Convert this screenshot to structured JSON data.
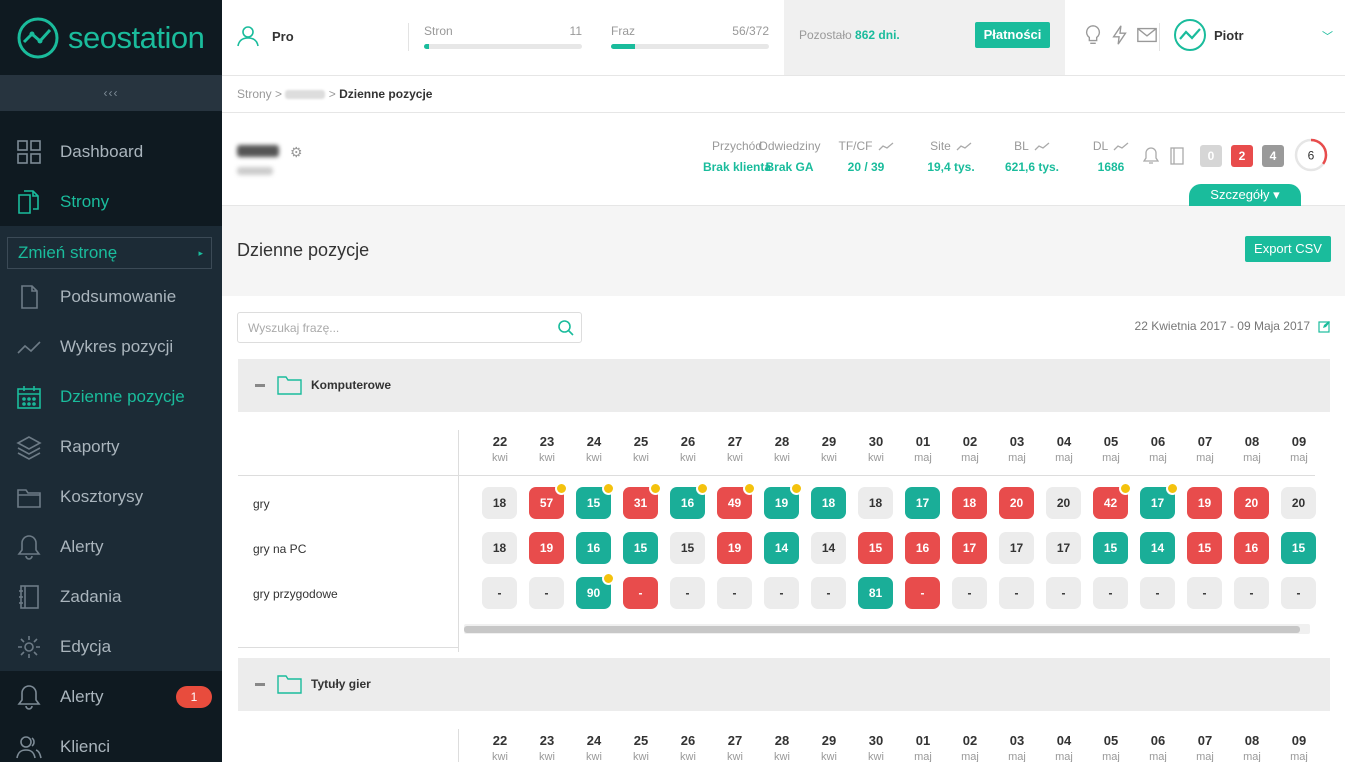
{
  "app": {
    "logo_a": "seo",
    "logo_b": "station"
  },
  "sidebar": {
    "collapse": "‹‹‹",
    "top_items": [
      {
        "label": "Dashboard",
        "icon": "grid-icon"
      },
      {
        "label": "Strony",
        "icon": "pages-icon"
      }
    ],
    "change_site": "Zmień stronę",
    "items": [
      {
        "label": "Podsumowanie",
        "icon": "document-icon"
      },
      {
        "label": "Wykres pozycji",
        "icon": "line-chart-icon"
      },
      {
        "label": "Dzienne pozycje",
        "icon": "calendar-icon"
      },
      {
        "label": "Raporty",
        "icon": "layers-icon"
      },
      {
        "label": "Kosztorysy",
        "icon": "folder-icon"
      },
      {
        "label": "Alerty",
        "icon": "bell-icon"
      },
      {
        "label": "Zadania",
        "icon": "notebook-icon"
      },
      {
        "label": "Edycja",
        "icon": "gear-icon"
      }
    ],
    "bottom_items": [
      {
        "label": "Alerty",
        "icon": "bell-icon",
        "badge": "1"
      },
      {
        "label": "Klienci",
        "icon": "users-icon"
      }
    ]
  },
  "topbar": {
    "plan": "Pro",
    "pages": {
      "label": "Stron",
      "value": "11",
      "fill": 0.03
    },
    "phrases": {
      "label": "Fraz",
      "value": "56/372",
      "fill": 0.15
    },
    "remaining_prefix": "Pozostało",
    "remaining_value": "862 dni.",
    "pay_button": "Płatności",
    "user": "Piotr"
  },
  "breadcrumb": {
    "root": "Strony",
    "sep": ">",
    "current": "Dzienne pozycje"
  },
  "site_stats": [
    {
      "label": "Przychód",
      "value": "Brak klienta",
      "trend": false
    },
    {
      "label": "Odwiedziny",
      "value": "Brak GA",
      "trend": false
    },
    {
      "label": "TF/CF",
      "value": "20 / 39",
      "trend": true
    },
    {
      "label": "Site",
      "value": "19,4 tys.",
      "trend": true
    },
    {
      "label": "BL",
      "value": "621,6 tys.",
      "trend": true
    },
    {
      "label": "DL",
      "value": "1686",
      "trend": true
    }
  ],
  "counters": [
    {
      "value": "0",
      "color": "#d6d6d6"
    },
    {
      "value": "2",
      "color": "#e84c4c"
    },
    {
      "value": "4",
      "color": "#9a9a9a"
    }
  ],
  "score": {
    "value": "6",
    "fraction": 0.35
  },
  "details_button": "Szczegóły ▾",
  "page": {
    "title": "Dzienne pozycje",
    "export": "Export CSV",
    "search_placeholder": "Wyszukaj frazę...",
    "date_range": "22 Kwietnia 2017 - 09 Maja 2017"
  },
  "dates": [
    {
      "d": "22",
      "m": "kwi"
    },
    {
      "d": "23",
      "m": "kwi"
    },
    {
      "d": "24",
      "m": "kwi"
    },
    {
      "d": "25",
      "m": "kwi"
    },
    {
      "d": "26",
      "m": "kwi"
    },
    {
      "d": "27",
      "m": "kwi"
    },
    {
      "d": "28",
      "m": "kwi"
    },
    {
      "d": "29",
      "m": "kwi"
    },
    {
      "d": "30",
      "m": "kwi"
    },
    {
      "d": "01",
      "m": "maj"
    },
    {
      "d": "02",
      "m": "maj"
    },
    {
      "d": "03",
      "m": "maj"
    },
    {
      "d": "04",
      "m": "maj"
    },
    {
      "d": "05",
      "m": "maj"
    },
    {
      "d": "06",
      "m": "maj"
    },
    {
      "d": "07",
      "m": "maj"
    },
    {
      "d": "08",
      "m": "maj"
    },
    {
      "d": "09",
      "m": "maj"
    }
  ],
  "groups": [
    {
      "name": "Komputerowe",
      "rows": [
        {
          "phrase": "gry",
          "cells": [
            {
              "v": "18",
              "s": "n"
            },
            {
              "v": "57",
              "s": "r",
              "dot": true
            },
            {
              "v": "15",
              "s": "g",
              "dot": true
            },
            {
              "v": "31",
              "s": "r",
              "dot": true
            },
            {
              "v": "16",
              "s": "g",
              "dot": true
            },
            {
              "v": "49",
              "s": "r",
              "dot": true
            },
            {
              "v": "19",
              "s": "g",
              "dot": true
            },
            {
              "v": "18",
              "s": "g"
            },
            {
              "v": "18",
              "s": "n"
            },
            {
              "v": "17",
              "s": "g"
            },
            {
              "v": "18",
              "s": "r"
            },
            {
              "v": "20",
              "s": "r"
            },
            {
              "v": "20",
              "s": "n"
            },
            {
              "v": "42",
              "s": "r",
              "dot": true
            },
            {
              "v": "17",
              "s": "g",
              "dot": true
            },
            {
              "v": "19",
              "s": "r"
            },
            {
              "v": "20",
              "s": "r"
            },
            {
              "v": "20",
              "s": "n"
            }
          ]
        },
        {
          "phrase": "gry na PC",
          "cells": [
            {
              "v": "18",
              "s": "n"
            },
            {
              "v": "19",
              "s": "r"
            },
            {
              "v": "16",
              "s": "g"
            },
            {
              "v": "15",
              "s": "g"
            },
            {
              "v": "15",
              "s": "n"
            },
            {
              "v": "19",
              "s": "r"
            },
            {
              "v": "14",
              "s": "g"
            },
            {
              "v": "14",
              "s": "n"
            },
            {
              "v": "15",
              "s": "r"
            },
            {
              "v": "16",
              "s": "r"
            },
            {
              "v": "17",
              "s": "r"
            },
            {
              "v": "17",
              "s": "n"
            },
            {
              "v": "17",
              "s": "n"
            },
            {
              "v": "15",
              "s": "g"
            },
            {
              "v": "14",
              "s": "g"
            },
            {
              "v": "15",
              "s": "r"
            },
            {
              "v": "16",
              "s": "r"
            },
            {
              "v": "15",
              "s": "g"
            }
          ]
        },
        {
          "phrase": "gry przygodowe",
          "cells": [
            {
              "v": "-",
              "s": "n"
            },
            {
              "v": "-",
              "s": "n"
            },
            {
              "v": "90",
              "s": "g",
              "dot": true
            },
            {
              "v": "-",
              "s": "r"
            },
            {
              "v": "-",
              "s": "n"
            },
            {
              "v": "-",
              "s": "n"
            },
            {
              "v": "-",
              "s": "n"
            },
            {
              "v": "-",
              "s": "n"
            },
            {
              "v": "81",
              "s": "g"
            },
            {
              "v": "-",
              "s": "r"
            },
            {
              "v": "-",
              "s": "n"
            },
            {
              "v": "-",
              "s": "n"
            },
            {
              "v": "-",
              "s": "n"
            },
            {
              "v": "-",
              "s": "n"
            },
            {
              "v": "-",
              "s": "n"
            },
            {
              "v": "-",
              "s": "n"
            },
            {
              "v": "-",
              "s": "n"
            },
            {
              "v": "-",
              "s": "n"
            }
          ]
        }
      ]
    },
    {
      "name": "Tytuły gier",
      "rows": []
    }
  ],
  "colors": {
    "accent": "#1abc9c",
    "red": "#e84c4c",
    "dot": "#f4c20d"
  }
}
